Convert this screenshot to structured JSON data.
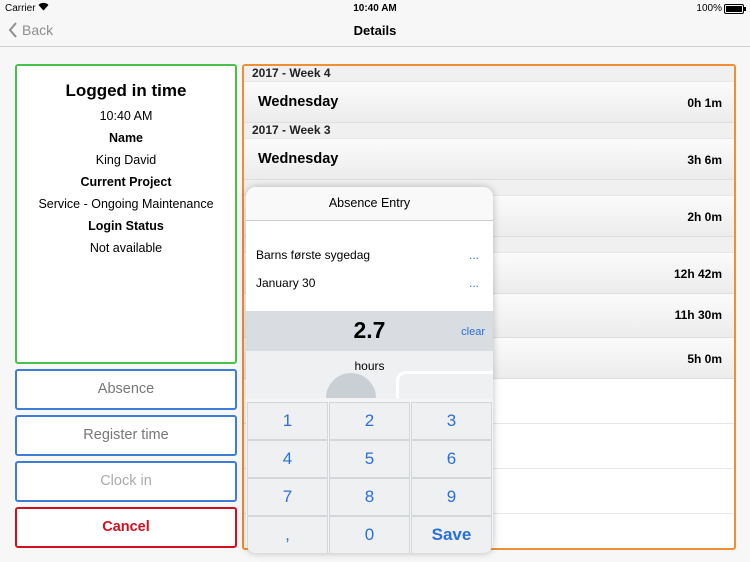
{
  "status": {
    "carrier": "Carrier",
    "time": "10:40 AM",
    "battery": "100%"
  },
  "nav": {
    "back": "Back",
    "title": "Details"
  },
  "info": {
    "heading": "Logged in time",
    "time": "10:40 AM",
    "name_label": "Name",
    "name": "King David",
    "project_label": "Current Project",
    "project": "Service - Ongoing Maintenance",
    "login_label": "Login Status",
    "login": "Not available"
  },
  "buttons": {
    "absence": "Absence",
    "register": "Register time",
    "clock": "Clock in",
    "cancel": "Cancel"
  },
  "list": {
    "week4": "2017 - Week 4",
    "week4_day": "Wednesday",
    "week4_hours": "0h 1m",
    "week3": "2017 - Week 3",
    "week3_day": "Wednesday",
    "week3_hours": "3h 6m",
    "hours": [
      "2h 0m",
      "12h 42m",
      "11h 30m",
      "5h 0m"
    ]
  },
  "popover": {
    "title": "Absence Entry",
    "reason": "Barns første sygedag",
    "date": "January 30",
    "more": "...",
    "value": "2.7",
    "clear": "clear",
    "unit": "hours",
    "keys": [
      "1",
      "2",
      "3",
      "4",
      "5",
      "6",
      "7",
      "8",
      "9",
      ",",
      "0",
      "Save"
    ]
  },
  "colors": {
    "green": "#49c148",
    "blue": "#3d7dd8",
    "red": "#d0101e",
    "orange": "#ef8e35",
    "link": "#2b6fdb"
  }
}
